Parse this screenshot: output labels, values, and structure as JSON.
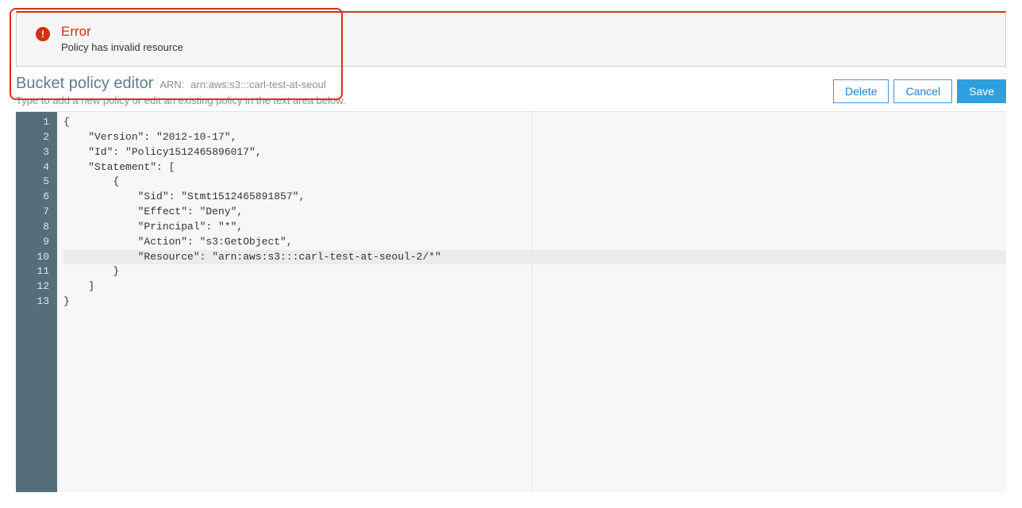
{
  "alert": {
    "title": "Error",
    "message": "Policy has invalid resource"
  },
  "header": {
    "title": "Bucket policy editor",
    "arn_label": "ARN:",
    "arn": "arn:aws:s3:::carl-test-at-seoul",
    "subtitle": "Type to add a new policy or edit an existing policy in the text area below."
  },
  "buttons": {
    "delete": "Delete",
    "cancel": "Cancel",
    "save": "Save"
  },
  "editor": {
    "highlighted_line": 10,
    "lines": [
      "{",
      "    \"Version\": \"2012-10-17\",",
      "    \"Id\": \"Policy1512465896017\",",
      "    \"Statement\": [",
      "        {",
      "            \"Sid\": \"Stmt1512465891857\",",
      "            \"Effect\": \"Deny\",",
      "            \"Principal\": \"*\",",
      "            \"Action\": \"s3:GetObject\",",
      "            \"Resource\": \"arn:aws:s3:::carl-test-at-seoul-2/*\"",
      "        }",
      "    ]",
      "}"
    ]
  }
}
